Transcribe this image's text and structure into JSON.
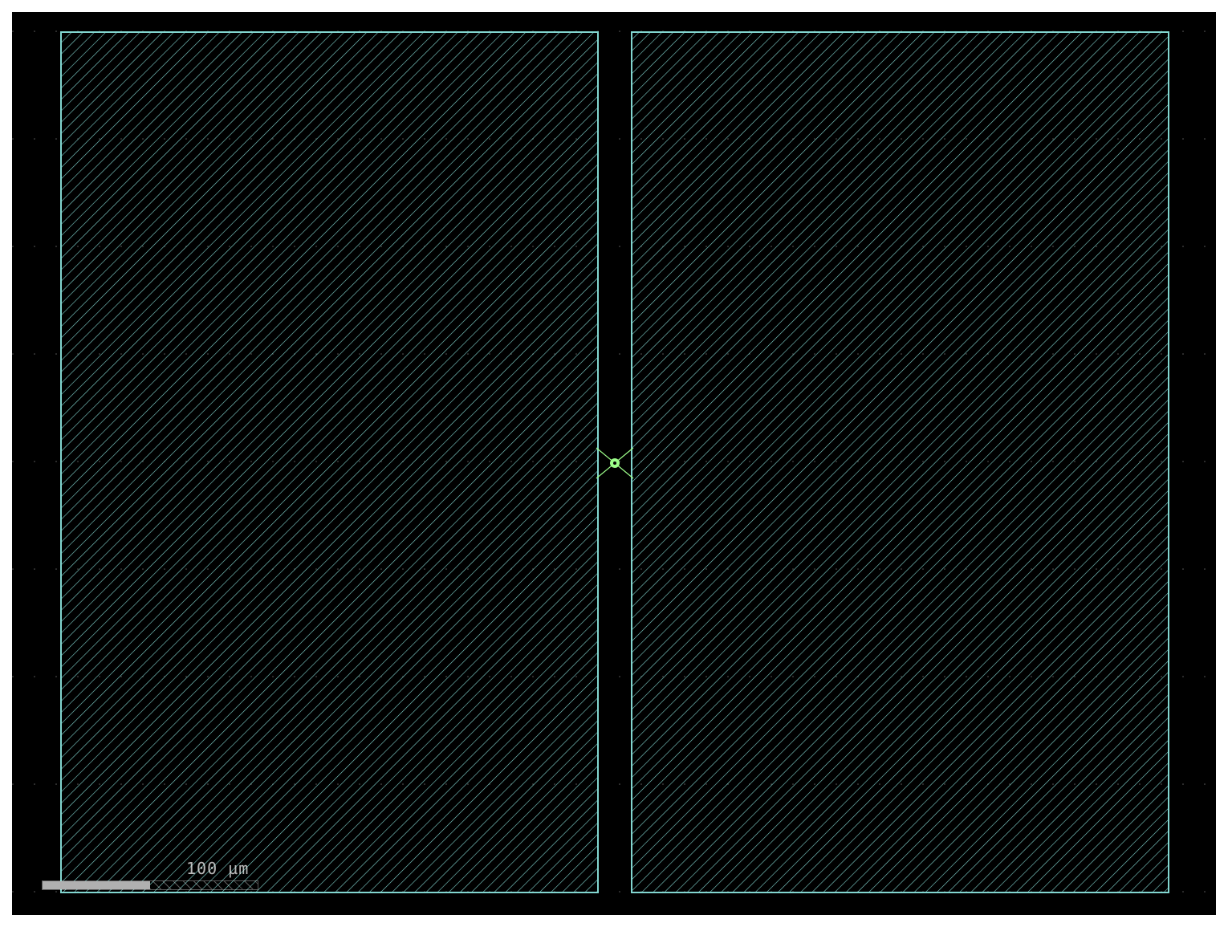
{
  "colors": {
    "background": "#000000",
    "grid_dot": "#5f5f5f",
    "layer_outline": "#82d6d0",
    "layer_hatch": "#82d6d0",
    "origin_marker": "#9dff8a",
    "scale_bar": "#b0b0b0",
    "scale_text": "#ffffff"
  },
  "layout_view": {
    "layers": [
      {
        "name": "left-rectangle",
        "hatch": "diagonal"
      },
      {
        "name": "right-rectangle",
        "hatch": "diagonal"
      }
    ]
  },
  "origin": {
    "icon": "origin-cross-icon"
  },
  "scale_bar": {
    "label": "100 µm",
    "filled_fraction": 0.5
  }
}
